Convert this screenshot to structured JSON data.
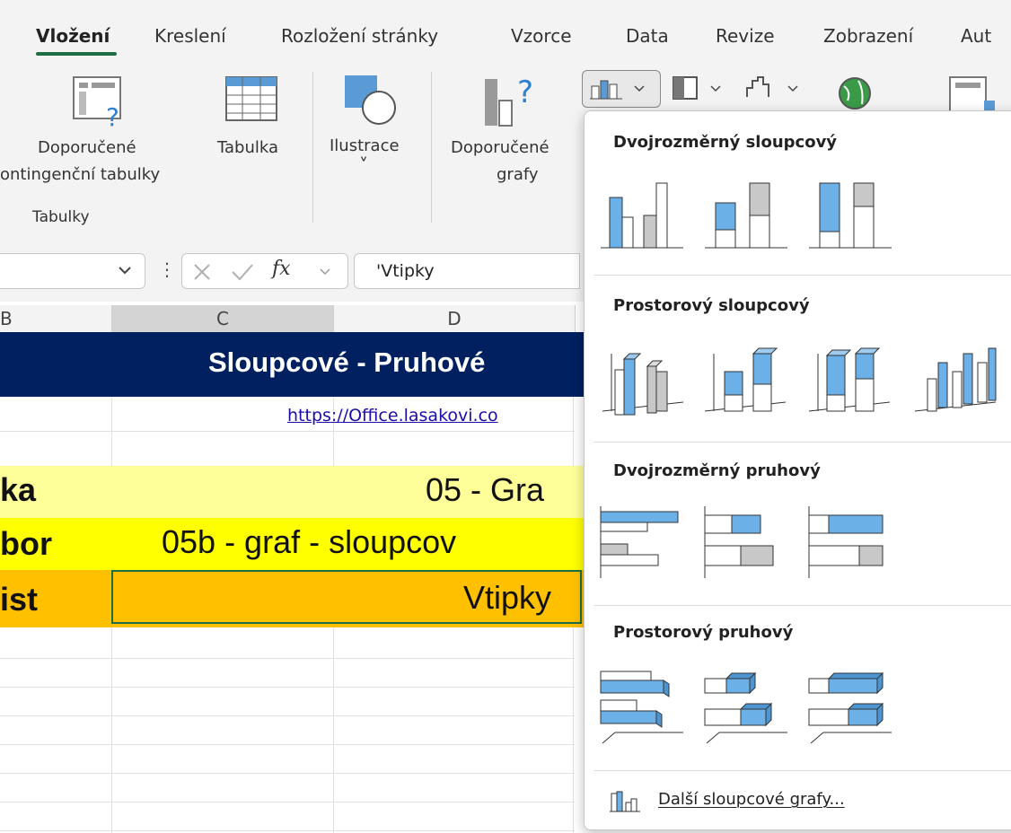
{
  "ribbon_tabs": [
    "Vložení",
    "Kreslení",
    "Rozložení stránky",
    "Vzorce",
    "Data",
    "Revize",
    "Zobrazení",
    "Aut"
  ],
  "ribbon": {
    "pivot_label_1": "Doporučené",
    "pivot_label_2": "ontingenční tabulky",
    "table_label": "Tabulka",
    "illustrations_label": "Ilustrace",
    "illustrations_chevron": "˅",
    "rec_charts_label_1": "Doporučené",
    "rec_charts_label_2": "grafy",
    "group_tables": "Tabulky"
  },
  "formula_bar": {
    "fx": "fx",
    "value": "'Vtipky"
  },
  "columns": [
    "B",
    "C",
    "D"
  ],
  "sheet": {
    "banner": "Sloupcové - Pruhové",
    "link": "https://Office.lasakovi.co",
    "row1_label": "ka",
    "row1_value": "05 - Gra",
    "row2_label": "bor",
    "row2_value": "05b - graf - sloupcov",
    "row3_label": "ist",
    "row3_value": "Vtipky"
  },
  "dropdown": {
    "sections": [
      "Dvojrozměrný sloupcový",
      "Prostorový sloupcový",
      "Dvojrozměrný pruhový",
      "Prostorový pruhový"
    ],
    "more_link": "Další sloupcové grafy..."
  },
  "colors": {
    "banner": "#002060",
    "row_yellow_light": "#ffff99",
    "row_yellow": "#ffff00",
    "row_orange": "#ffc000",
    "accent_green": "#1f6e43",
    "series_blue": "#6cb0e8",
    "series_gray": "#c8c8c8"
  }
}
